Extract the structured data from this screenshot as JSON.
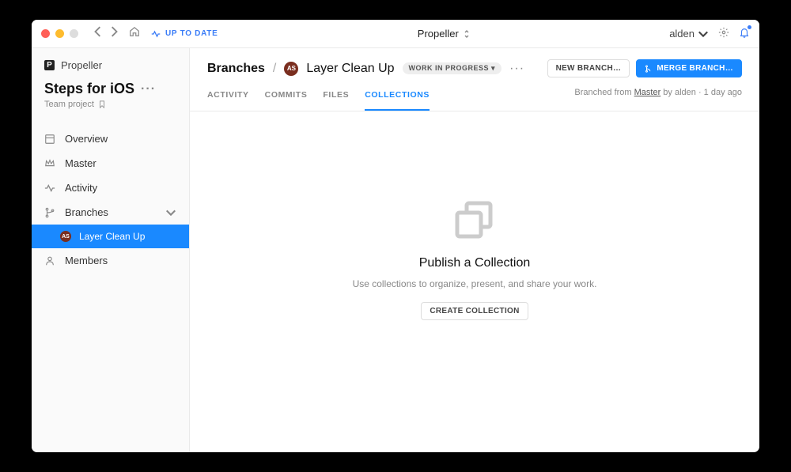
{
  "titlebar": {
    "status": "UP TO DATE",
    "app_title": "Propeller",
    "user": "alden"
  },
  "sidebar": {
    "brand": "Propeller",
    "project_name": "Steps for iOS",
    "project_sub": "Team project",
    "items": [
      {
        "label": "Overview"
      },
      {
        "label": "Master"
      },
      {
        "label": "Activity"
      },
      {
        "label": "Branches"
      },
      {
        "label": "Members"
      }
    ],
    "branch_child": {
      "avatar_initials": "AS",
      "label": "Layer Clean Up"
    }
  },
  "header": {
    "crumb_root": "Branches",
    "avatar_initials": "AS",
    "title": "Layer Clean Up",
    "status": "WORK IN PROGRESS ▾",
    "new_branch_btn": "NEW BRANCH…",
    "merge_btn": "MERGE BRANCH…"
  },
  "tabs": [
    {
      "label": "ACTIVITY"
    },
    {
      "label": "COMMITS"
    },
    {
      "label": "FILES"
    },
    {
      "label": "COLLECTIONS"
    }
  ],
  "branch_meta": {
    "prefix": "Branched from ",
    "parent": "Master",
    "by": " by alden · 1 day ago"
  },
  "empty": {
    "title": "Publish a Collection",
    "subtitle": "Use collections to organize, present, and share your work.",
    "button": "CREATE COLLECTION"
  }
}
